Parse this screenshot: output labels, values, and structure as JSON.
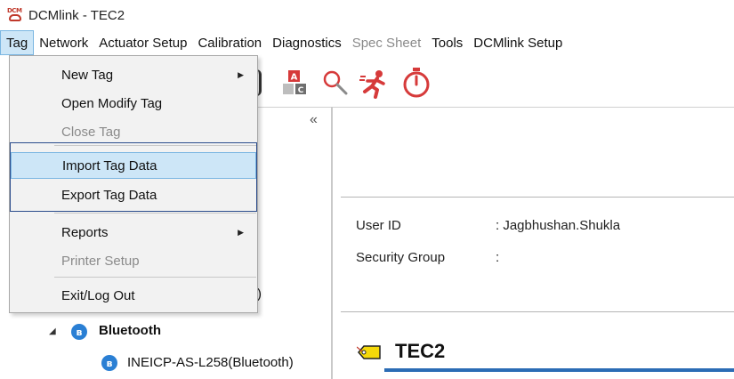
{
  "window": {
    "logo_text": "DCM",
    "title": "DCMlink - TEC2"
  },
  "menubar": {
    "items": [
      {
        "label": "Tag",
        "state": "active"
      },
      {
        "label": "Network",
        "state": "normal"
      },
      {
        "label": "Actuator Setup",
        "state": "normal"
      },
      {
        "label": "Calibration",
        "state": "normal"
      },
      {
        "label": "Diagnostics",
        "state": "normal"
      },
      {
        "label": "Spec Sheet",
        "state": "disabled"
      },
      {
        "label": "Tools",
        "state": "normal"
      },
      {
        "label": "DCMlink Setup",
        "state": "normal"
      }
    ]
  },
  "toolbar": {
    "icons": [
      "blank-icon",
      "tag-ab-icon",
      "search-icon",
      "running-man-icon",
      "stopwatch-icon"
    ],
    "collapse_glyph": "«"
  },
  "tag_menu": {
    "items": [
      {
        "label": "New Tag",
        "disabled": false,
        "submenu": true
      },
      {
        "label": "Open Modify Tag",
        "disabled": false,
        "submenu": false
      },
      {
        "label": "Close Tag",
        "disabled": true,
        "submenu": false
      },
      {
        "label": "Import Tag Data",
        "disabled": false,
        "submenu": false,
        "highlighted": true
      },
      {
        "label": "Export Tag Data",
        "disabled": false,
        "submenu": false
      },
      {
        "label": "Reports",
        "disabled": false,
        "submenu": true
      },
      {
        "label": "Printer Setup",
        "disabled": true,
        "submenu": false
      },
      {
        "label": "Exit/Log Out",
        "disabled": false,
        "submenu": false
      }
    ],
    "submenu_glyph": "▶"
  },
  "tree": {
    "partial_text": ")",
    "group": {
      "label": "Bluetooth",
      "expand_glyph": "◢"
    },
    "device": {
      "label": "INEICP-AS-L258(Bluetooth)"
    },
    "bluetooth_glyph": "ʙ"
  },
  "info": {
    "user_id_label": "User ID",
    "user_id_value": ": Jagbhushan.Shukla",
    "security_group_label": "Security Group",
    "security_group_value": ":"
  },
  "tag_heading": "TEC2",
  "colors": {
    "accent": "#2b6cb5",
    "menu_highlight": "#cde6f7",
    "focus_border": "#2b4c8c",
    "logo_red": "#c0392b"
  }
}
